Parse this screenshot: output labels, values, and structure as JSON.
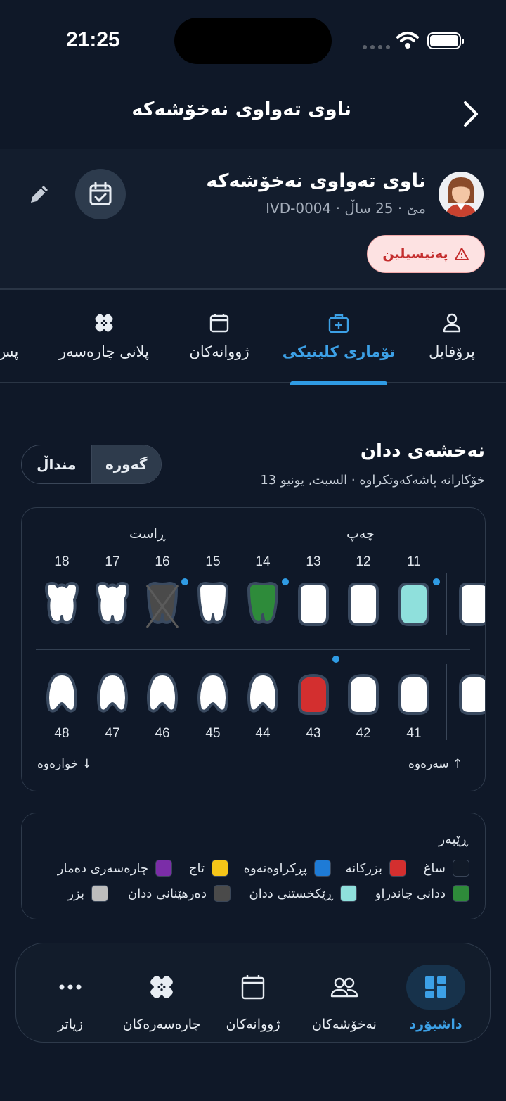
{
  "status_bar": {
    "time": "21:25"
  },
  "header": {
    "title": "ناوی تەواوی نەخۆشەکە"
  },
  "patient": {
    "name": "ناوی تەواوی نەخۆشەکە",
    "meta": "IVD-0004 · مێ · 25 ساڵ",
    "allergy": "پەنیسیلین"
  },
  "tabs": [
    {
      "label": "پرۆفایل",
      "icon": "person-icon"
    },
    {
      "label": "تۆماری کلینیکی",
      "icon": "medical-kit-icon",
      "active": true
    },
    {
      "label": "ژووانەکان",
      "icon": "calendar-icon"
    },
    {
      "label": "پلانی چارەسەر",
      "icon": "bandage-icon"
    },
    {
      "label": "پس",
      "icon": ""
    }
  ],
  "chart": {
    "title": "نەخشەی ددان",
    "subtitle": "خۆکارانە پاشەکەوتکراوە · السبت, يونيو 13",
    "segment": {
      "adult": "گەورە",
      "child": "منداڵ",
      "selected": "adult"
    },
    "side_left": "چەپ",
    "side_right": "ڕاست",
    "scroll_up": "سەرەوە",
    "scroll_down": "خوارەوە",
    "upper_teeth": [
      {
        "num": "11",
        "condition": "implant",
        "note": true
      },
      {
        "num": "12",
        "condition": "healthy"
      },
      {
        "num": "13",
        "condition": "healthy"
      },
      {
        "num": "14",
        "condition": "bridge_green",
        "note": true
      },
      {
        "num": "15",
        "condition": "healthy"
      },
      {
        "num": "16",
        "condition": "extracted",
        "note": true
      },
      {
        "num": "17",
        "condition": "healthy"
      },
      {
        "num": "18",
        "condition": "healthy"
      }
    ],
    "lower_teeth": [
      {
        "num": "41",
        "condition": "healthy"
      },
      {
        "num": "42",
        "condition": "healthy"
      },
      {
        "num": "43",
        "condition": "decay",
        "note": true
      },
      {
        "num": "44",
        "condition": "healthy"
      },
      {
        "num": "45",
        "condition": "healthy"
      },
      {
        "num": "46",
        "condition": "healthy"
      },
      {
        "num": "47",
        "condition": "healthy"
      },
      {
        "num": "48",
        "condition": "healthy"
      }
    ],
    "partial_upper_num": "2",
    "partial_lower_num": "3"
  },
  "legend": {
    "title": "ڕێبەر",
    "items": [
      {
        "label": "ساغ",
        "color": "#111a28"
      },
      {
        "label": "بزرکانە",
        "color": "#d32f2f"
      },
      {
        "label": "پڕکراوەتەوە",
        "color": "#1e7bd6"
      },
      {
        "label": "تاج",
        "color": "#f5c518"
      },
      {
        "label": "چارەسەری دەمار",
        "color": "#7b2da8"
      },
      {
        "label": "ددانی چاندراو",
        "color": "#2e8b3a"
      },
      {
        "label": "ڕێکخستنی ددان",
        "color": "#8fe0dc"
      },
      {
        "label": "دەرهێنانی ددان",
        "color": "#4a4a4a"
      },
      {
        "label": "بزر",
        "color": "#bdbdbd"
      }
    ]
  },
  "nav": [
    {
      "label": "داشبۆرد",
      "icon": "dashboard-icon",
      "active": true
    },
    {
      "label": "نەخۆشەکان",
      "icon": "users-icon"
    },
    {
      "label": "ژووانەکان",
      "icon": "calendar-icon"
    },
    {
      "label": "چارەسەرەکان",
      "icon": "bandage-icon"
    },
    {
      "label": "زیاتر",
      "icon": "more-icon"
    }
  ],
  "colors": {
    "accent": "#2f9be4",
    "background": "#0f1828",
    "tooth_healthy": "#ffffff",
    "tooth_outline": "#3a4a60",
    "implant": "#8fe0dc",
    "bridge_green": "#2e8b3a",
    "decay": "#d32f2f",
    "extracted": "#4a4a4a"
  }
}
